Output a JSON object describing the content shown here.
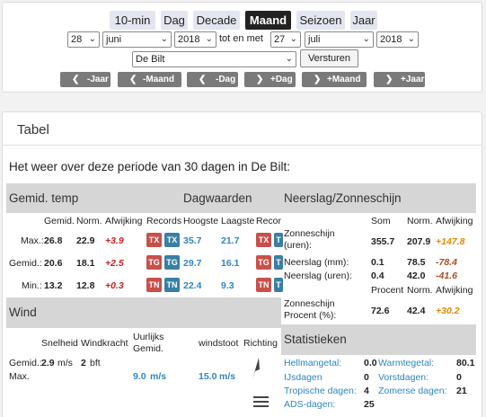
{
  "periods": [
    "10-min",
    "Dag",
    "Decade",
    "Maand",
    "Seizoen",
    "Jaar"
  ],
  "active_period": "Maand",
  "form": {
    "start_day": "28",
    "start_month": "juni",
    "start_year": "2018",
    "between": "tot en met",
    "end_day": "27",
    "end_month": "juli",
    "end_year": "2018",
    "station": "De Bilt",
    "submit": "Versturen"
  },
  "nav": [
    "-Jaar",
    "-Maand",
    "-Dag",
    "+Dag",
    "+Maand",
    "+Jaar"
  ],
  "table": {
    "title": "Tabel",
    "intro": "Het weer over deze periode van 30 dagen in De Bilt:",
    "temp": {
      "header": "Gemid. temp",
      "cols": [
        "Gemid.",
        "Norm.",
        "Afwijking",
        "Records"
      ],
      "rows": [
        {
          "label": "Max.:",
          "gemid": "26.8",
          "norm": "22.9",
          "afw": "+3.9",
          "b1": "TX",
          "b2": "TX"
        },
        {
          "label": "Gemid.:",
          "gemid": "20.6",
          "norm": "18.1",
          "afw": "+2.5",
          "b1": "TG",
          "b2": "TG"
        },
        {
          "label": "Min.:",
          "gemid": "13.2",
          "norm": "12.8",
          "afw": "+0.3",
          "b1": "TN",
          "b2": "TN"
        }
      ]
    },
    "dag": {
      "header": "Dagwaarden",
      "cols": [
        "Hoogste",
        "Laagste",
        "Recor"
      ],
      "rows": [
        {
          "hoog": "35.7",
          "laag": "21.7",
          "b1": "TX",
          "b2": "T"
        },
        {
          "hoog": "29.7",
          "laag": "16.1",
          "b1": "TG",
          "b2": "T"
        },
        {
          "hoog": "22.4",
          "laag": "9.3",
          "b1": "TN",
          "b2": "T"
        }
      ]
    },
    "neerslag": {
      "header": "Neerslag/Zonneschijn",
      "cols": [
        "Som",
        "Norm.",
        "Afwijking"
      ],
      "rows": [
        {
          "label": "Zonneschijn (uren):",
          "som": "355.7",
          "norm": "207.9",
          "afw": "+147.8"
        },
        {
          "label": "Neerslag (mm):",
          "som": "0.1",
          "norm": "78.5",
          "afw": "-78.4"
        },
        {
          "label": "Neerslag (uren):",
          "som": "0.4",
          "norm": "42.0",
          "afw": "-41.6"
        }
      ],
      "cols2": [
        "Procent",
        "Norm.",
        "Afwijking"
      ],
      "procent": {
        "label": "Zonneschijn Procent (%):",
        "som": "72.6",
        "norm": "42.4",
        "afw": "+30.2"
      }
    },
    "wind": {
      "header": "Wind",
      "cols": [
        "Snelheid",
        "Windkracht",
        "Uurlijks Gemid.",
        "windstoot",
        "Richting"
      ],
      "gemid_label": "Gemid.:",
      "gemid_speed": "2.9",
      "unit": "m/s",
      "bft_value": "2",
      "bft_unit": "bft",
      "max_label": "Max.",
      "uurlijks": "9.0",
      "stoot": "15.0"
    },
    "stats": {
      "header": "Statistieken",
      "rows": [
        {
          "l1": "Hellmangetal:",
          "v1": "0.0",
          "l2": "Warmtegetal:",
          "v2": "80.1"
        },
        {
          "l1": "IJsdagen",
          "v1": "0",
          "l2": "Vorstdagen:",
          "v2": "0"
        },
        {
          "l1": "Tropische dagen:",
          "v1": "4",
          "l2": "Zomerse dagen:",
          "v2": "21"
        },
        {
          "l1": "ADS-dagen:",
          "v1": "25",
          "l2": "",
          "v2": ""
        }
      ]
    }
  },
  "colors": {
    "accent_blue": "#2e86c1",
    "positive_red": "#cc1f1f",
    "positive_orange": "#e08a00",
    "negative_brown": "#b04a1a",
    "badge_red": "#c8504a",
    "badge_blue": "#3a7fa3"
  },
  "icons": [
    "chevron-down-icon",
    "arrow-left-icon",
    "arrow-right-icon",
    "wind-direction-arrow-icon",
    "menu-icon"
  ]
}
